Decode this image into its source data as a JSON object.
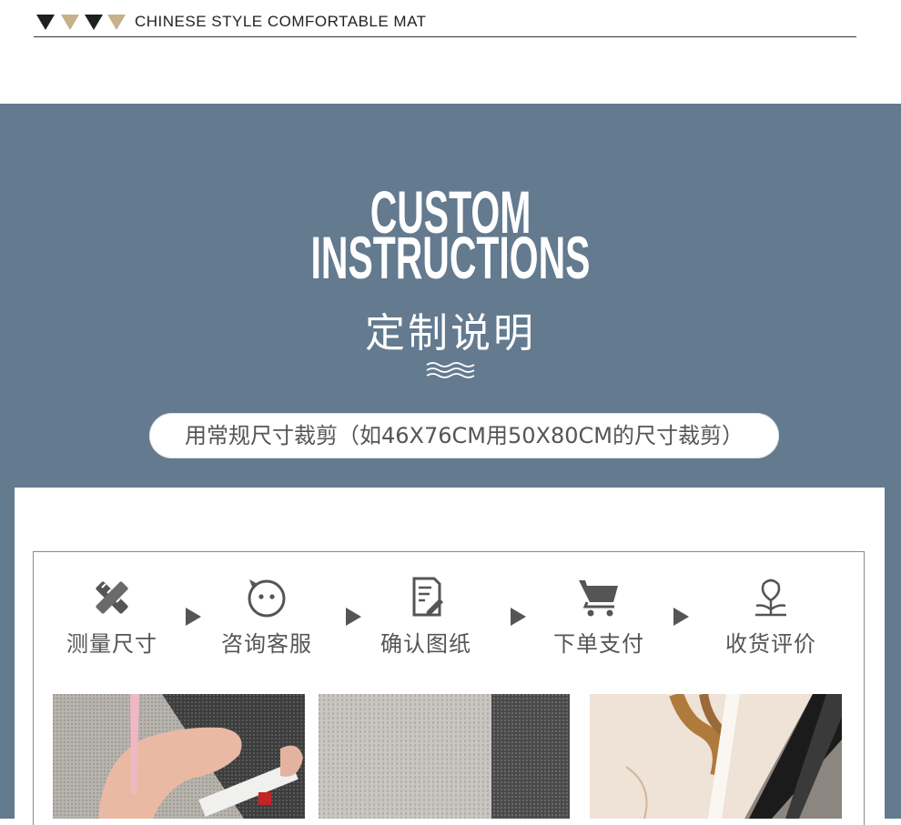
{
  "header": {
    "title": "CHINESE STYLE COMFORTABLE MAT",
    "triangles": [
      "dark",
      "tan",
      "dark",
      "tan"
    ]
  },
  "section": {
    "title_en_line1": "CUSTOM",
    "title_en_line2": "INSTRUCTIONS",
    "title_cn": "定制说明",
    "note": "用常规尺寸裁剪（如46X76CM用50X80CM的尺寸裁剪）"
  },
  "colors": {
    "band": "#637a8f",
    "accent_tan": "#c8b08a",
    "icon": "#555555"
  },
  "steps": [
    {
      "label": "测量尺寸",
      "icon": "pencil-ruler-icon"
    },
    {
      "label": "咨询客服",
      "icon": "smiley-face-icon"
    },
    {
      "label": "确认图纸",
      "icon": "document-edit-icon"
    },
    {
      "label": "下单支付",
      "icon": "shopping-cart-icon"
    },
    {
      "label": "收货评价",
      "icon": "tulip-flower-icon"
    }
  ],
  "photos": [
    {
      "name": "measuring-mat-photo"
    },
    {
      "name": "mat-texture-photo"
    },
    {
      "name": "marble-edge-photo"
    }
  ]
}
